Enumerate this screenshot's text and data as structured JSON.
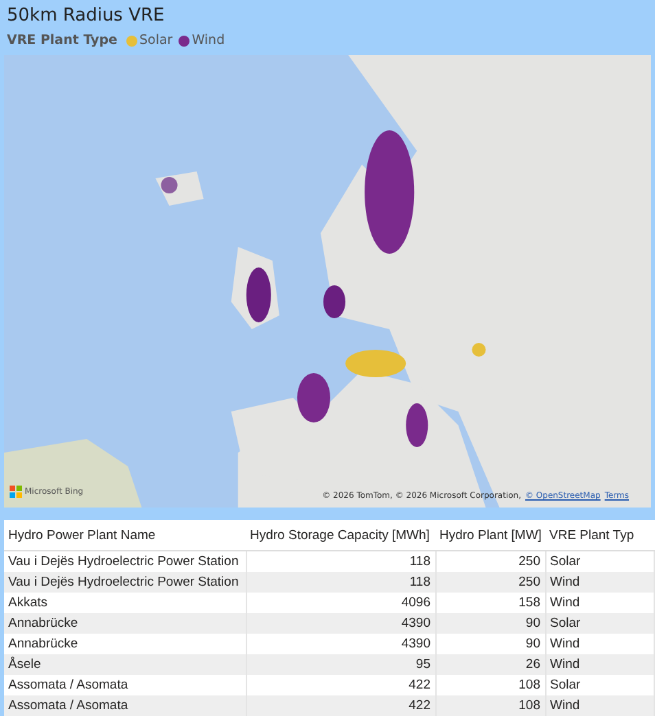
{
  "title": "50km Radius VRE",
  "legend": {
    "label": "VRE Plant Type",
    "items": [
      {
        "label": "Solar",
        "color": "#e6bf3a"
      },
      {
        "label": "Wind",
        "color": "#7a2a8c"
      }
    ]
  },
  "map": {
    "brand": "Microsoft Bing",
    "attribution": "© 2026 TomTom, © 2026 Microsoft Corporation,",
    "attribution_link": "© OpenStreetMap",
    "terms_link": "Terms"
  },
  "table": {
    "columns": [
      "Hydro Power Plant Name",
      "Hydro Storage Capacity [MWh]",
      "Hydro Plant [MW]",
      "VRE Plant Typ"
    ],
    "rows": [
      [
        "Vau i Dejës Hydroelectric Power Station",
        "118",
        "250",
        "Solar"
      ],
      [
        "Vau i Dejës Hydroelectric Power Station",
        "118",
        "250",
        "Wind"
      ],
      [
        "Akkats",
        "4096",
        "158",
        "Wind"
      ],
      [
        "Annabrücke",
        "4390",
        "90",
        "Solar"
      ],
      [
        "Annabrücke",
        "4390",
        "90",
        "Wind"
      ],
      [
        "Åsele",
        "95",
        "26",
        "Wind"
      ],
      [
        "Assomata / Asomata",
        "422",
        "108",
        "Solar"
      ],
      [
        "Assomata / Asomata",
        "422",
        "108",
        "Wind"
      ]
    ]
  }
}
